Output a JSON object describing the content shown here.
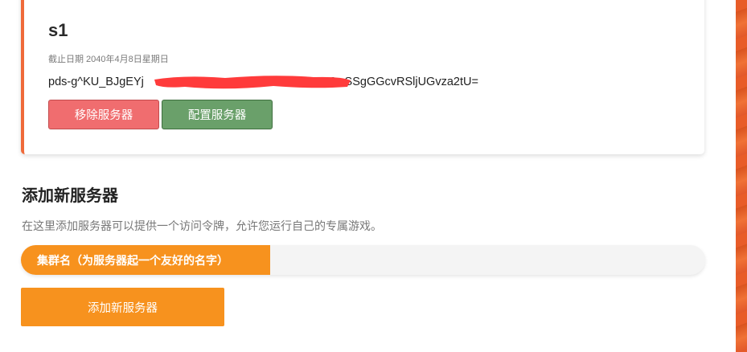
{
  "server": {
    "name": "s1",
    "expiry": "截止日期 2040年4月8日星期日",
    "token_prefix": "pds-g^KU_BJgEYj",
    "token_suffix": "9wSSgGGcvRSljUGvza2tU=",
    "remove_label": "移除服务器",
    "configure_label": "配置服务器",
    "redaction_color": "#ff3b3b"
  },
  "add_server": {
    "title": "添加新服务器",
    "description": "在这里添加服务器可以提供一个访问令牌，允许您运行自己的专属游戏。",
    "name_label": "集群名（为服务器起一个友好的名字）",
    "name_value": "",
    "button_label": "添加新服务器"
  },
  "colors": {
    "accent": "#f7921e",
    "card_border": "#ef6a3a",
    "danger": "#f06d6f",
    "success": "#6aa06a"
  }
}
